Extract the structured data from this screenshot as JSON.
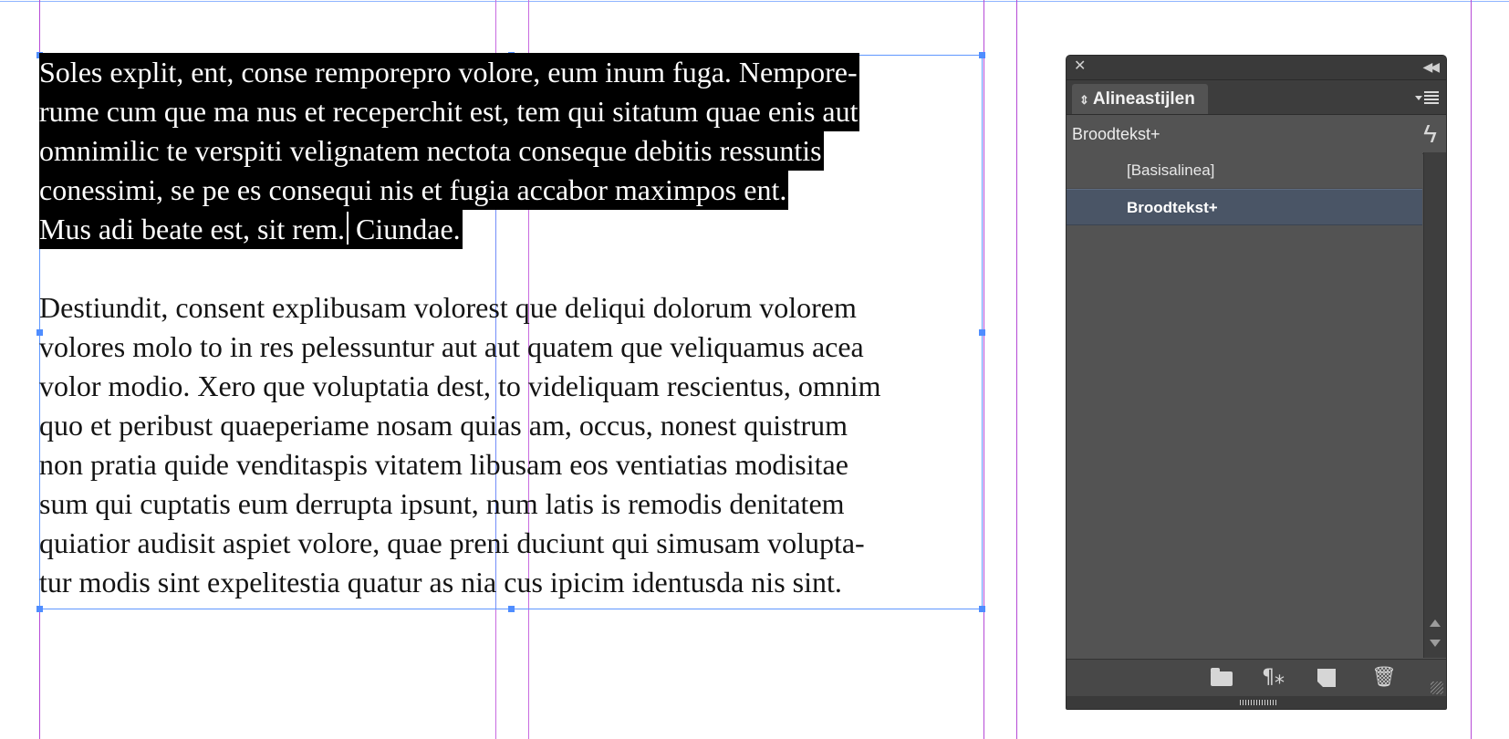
{
  "document": {
    "selected_paragraph": [
      "Soles explit, ent, conse remporepro volore, eum inum fuga. Nempore-",
      "rume cum que ma nus et receperchit est, tem qui sitatum quae enis aut",
      "omnimilic te verspiti velignatem nectota conseque debitis ressuntis",
      "conessimi, se pe es consequi nis et fugia accabor maximpos ent.",
      "Mus adi beate est, sit rem.",
      "Ciundae."
    ],
    "body_paragraph": [
      "Destiundit, consent explibusam volorest que deliqui dolorum volorem",
      "volores molo to in res pelessuntur aut aut quatem que veliquamus acea",
      "volor modio. Xero que voluptatia dest, to videliquam rescientus, omnim",
      "quo et peribust quaeperiame nosam quias am, occus, nonest quistrum",
      "non pratia quide venditaspis vitatem libusam eos ventiatias modisitae",
      "sum qui cuptatis eum derrupta ipsunt, num latis is remodis denitatem",
      "quiatior audisit aspiet volore, quae preni duciunt qui simusam volupta-",
      "tur modis sint expelitestia quatur as nia cus ipicim identusda nis sint."
    ]
  },
  "panel": {
    "tab_label": "Alineastijlen",
    "current_style": "Broodtekst+",
    "styles": [
      {
        "label": "[Basisalinea]",
        "selected": false
      },
      {
        "label": "Broodtekst+",
        "selected": true
      }
    ],
    "icons": {
      "close": "close-icon",
      "collapse": "collapse-icon",
      "menu": "panel-menu-icon",
      "clear_overrides": "lightning-icon",
      "footer": [
        "folder-icon",
        "pilcrow-icon",
        "new-style-icon",
        "trash-icon"
      ]
    }
  },
  "colors": {
    "selection": "#000000",
    "frame": "#5f97ff",
    "guides": "#b64ad6",
    "panel_bg": "#535353",
    "selected_row": "#4a5566"
  }
}
